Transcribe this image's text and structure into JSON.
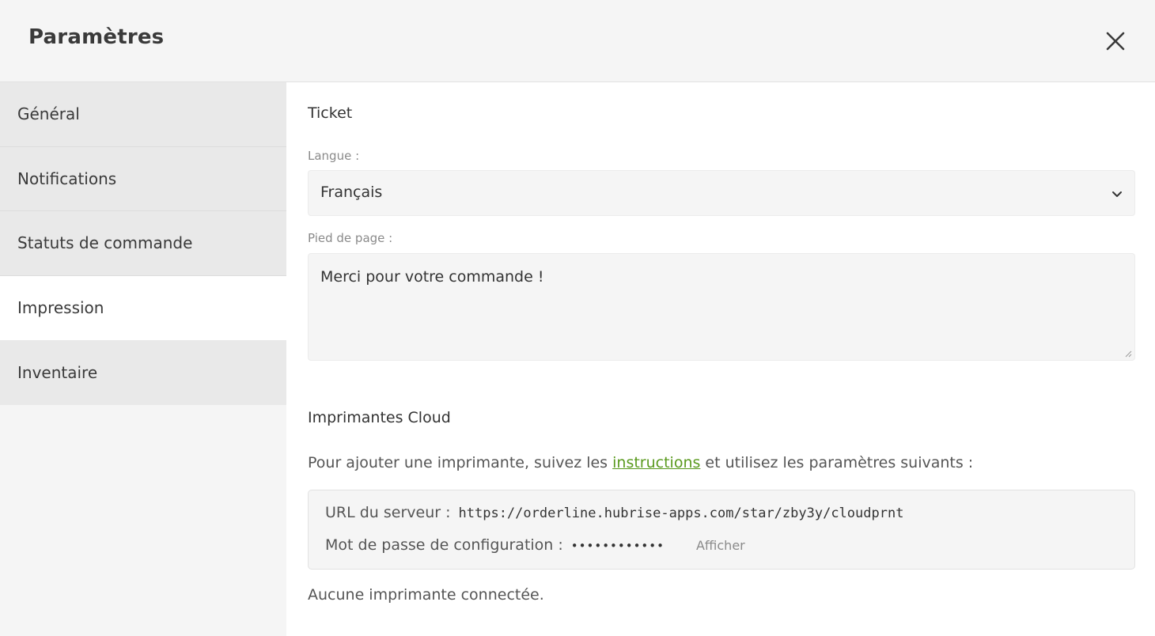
{
  "header": {
    "title": "Paramètres",
    "close_icon": "close-icon"
  },
  "sidebar": {
    "items": [
      {
        "label": "Général",
        "active": false
      },
      {
        "label": "Notifications",
        "active": false
      },
      {
        "label": "Statuts de commande",
        "active": false
      },
      {
        "label": "Impression",
        "active": true
      },
      {
        "label": "Inventaire",
        "active": false
      }
    ]
  },
  "ticket": {
    "title": "Ticket",
    "language_label": "Langue :",
    "language_value": "Français",
    "footer_label": "Pied de page :",
    "footer_value": "Merci pour votre commande !"
  },
  "cloud": {
    "title": "Imprimantes Cloud",
    "intro_before": "Pour ajouter une imprimante, suivez les ",
    "intro_link": "instructions",
    "intro_after": " et utilisez les paramètres suivants :",
    "server_url_label": "URL du serveur :",
    "server_url_value": "https://orderline.hubrise-apps.com/star/zby3y/cloudprnt",
    "password_label": "Mot de passe de configuration :",
    "password_value": "••••••••••••",
    "show_label": "Afficher",
    "status": "Aucune imprimante connectée."
  },
  "colors": {
    "link": "#5a9a1e",
    "sidebar_bg": "#e9e9e9",
    "active_bg": "#ffffff",
    "header_bg": "#f5f5f5"
  }
}
